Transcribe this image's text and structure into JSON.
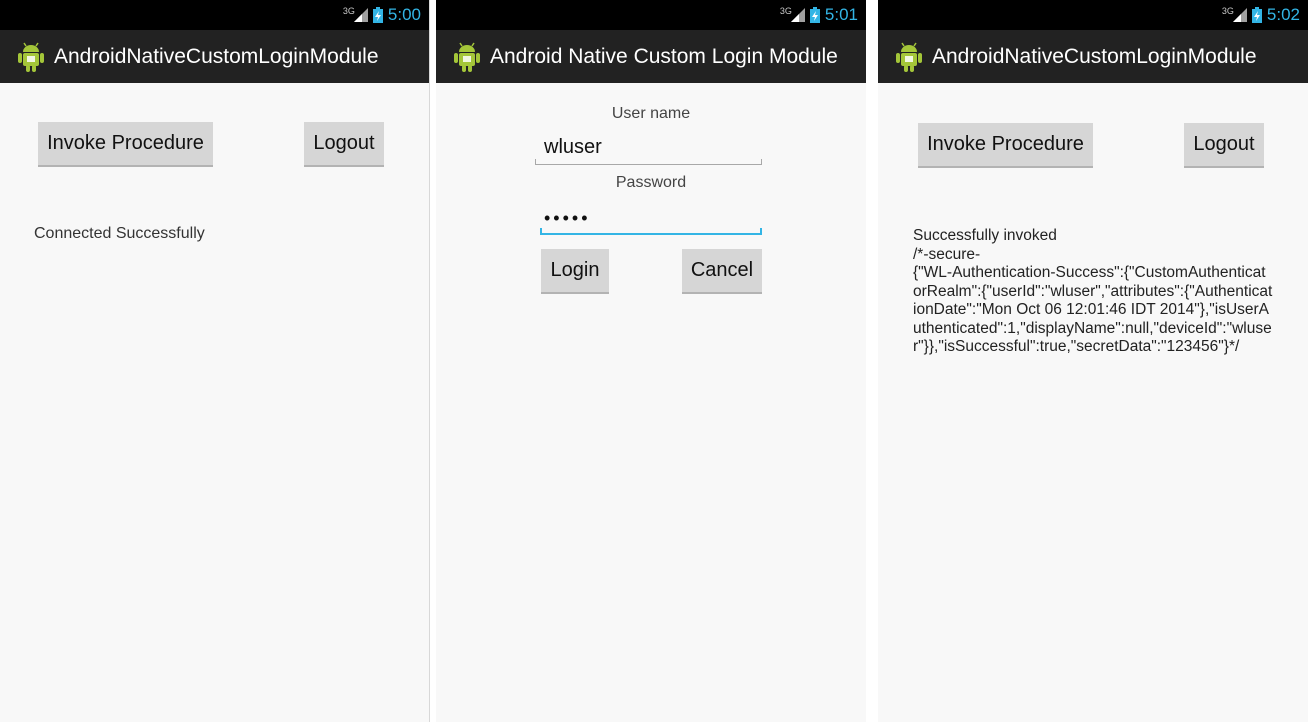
{
  "status_bar": {
    "network": "3G",
    "time_1": "5:00",
    "time_2": "5:01",
    "time_3": "5:02",
    "clock_color": "#33b5e5"
  },
  "screen_1": {
    "title": "AndroidNativeCustomLoginModule",
    "invoke_label": "Invoke Procedure",
    "logout_label": "Logout",
    "message": "Connected Successfully"
  },
  "screen_2": {
    "title": "Android Native Custom Login Module",
    "username_label": "User name",
    "username_value": "wluser",
    "password_label": "Password",
    "password_value": "•••••",
    "login_label": "Login",
    "cancel_label": "Cancel"
  },
  "screen_3": {
    "title": "AndroidNativeCustomLoginModule",
    "invoke_label": "Invoke Procedure",
    "logout_label": "Logout",
    "result_text": "Successfully invoked\n/*-secure-\n{\"WL-Authentication-Success\":{\"CustomAuthenticatorRealm\":{\"userId\":\"wluser\",\"attributes\":{\"AuthenticationDate\":\"Mon Oct 06 12:01:46 IDT 2014\"},\"isUserAuthenticated\":1,\"displayName\":null,\"deviceId\":\"wluser\"}},\"isSuccessful\":true,\"secretData\":\"123456\"}*/"
  },
  "icons": {
    "app": "android-robot-icon",
    "signal": "signal-strength-icon",
    "battery": "battery-charging-icon"
  },
  "colors": {
    "action_bar": "#222222",
    "status_bar": "#000000",
    "focus_accent": "#33b5e5",
    "button": "#d6d6d6",
    "background": "#f8f8f8"
  }
}
